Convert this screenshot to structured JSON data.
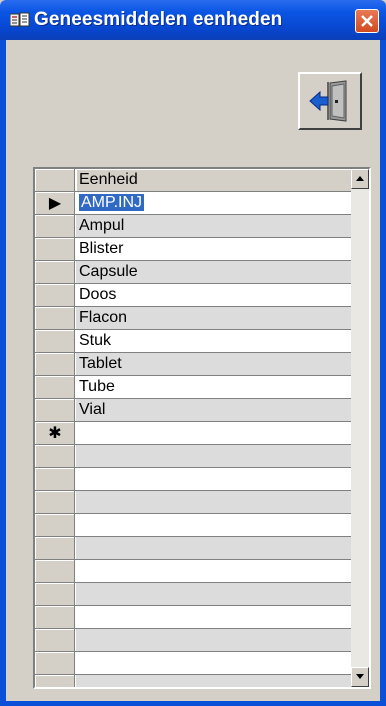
{
  "window": {
    "title": "Geneesmiddelen eenheden",
    "title_icon": "form-icon",
    "close_icon": "close-icon"
  },
  "toolbar": {
    "exit_icon": "exit-door-icon"
  },
  "grid": {
    "column_header": "Eenheid",
    "current_row_marker": "▶",
    "new_row_marker": "✱",
    "rows": [
      "AMP.INJ",
      "Ampul",
      "Blister",
      "Capsule",
      "Doos",
      "Flacon",
      "Stuk",
      "Tablet",
      "Tube",
      "Vial"
    ],
    "selected_row_index": 0,
    "scroll_up_icon": "scroll-up-icon",
    "scroll_down_icon": "scroll-down-icon"
  },
  "colors": {
    "titlebar": "#0a55e4",
    "selection": "#316ac5",
    "close_button": "#d24a20",
    "row_alt": "#dcdcdc"
  }
}
